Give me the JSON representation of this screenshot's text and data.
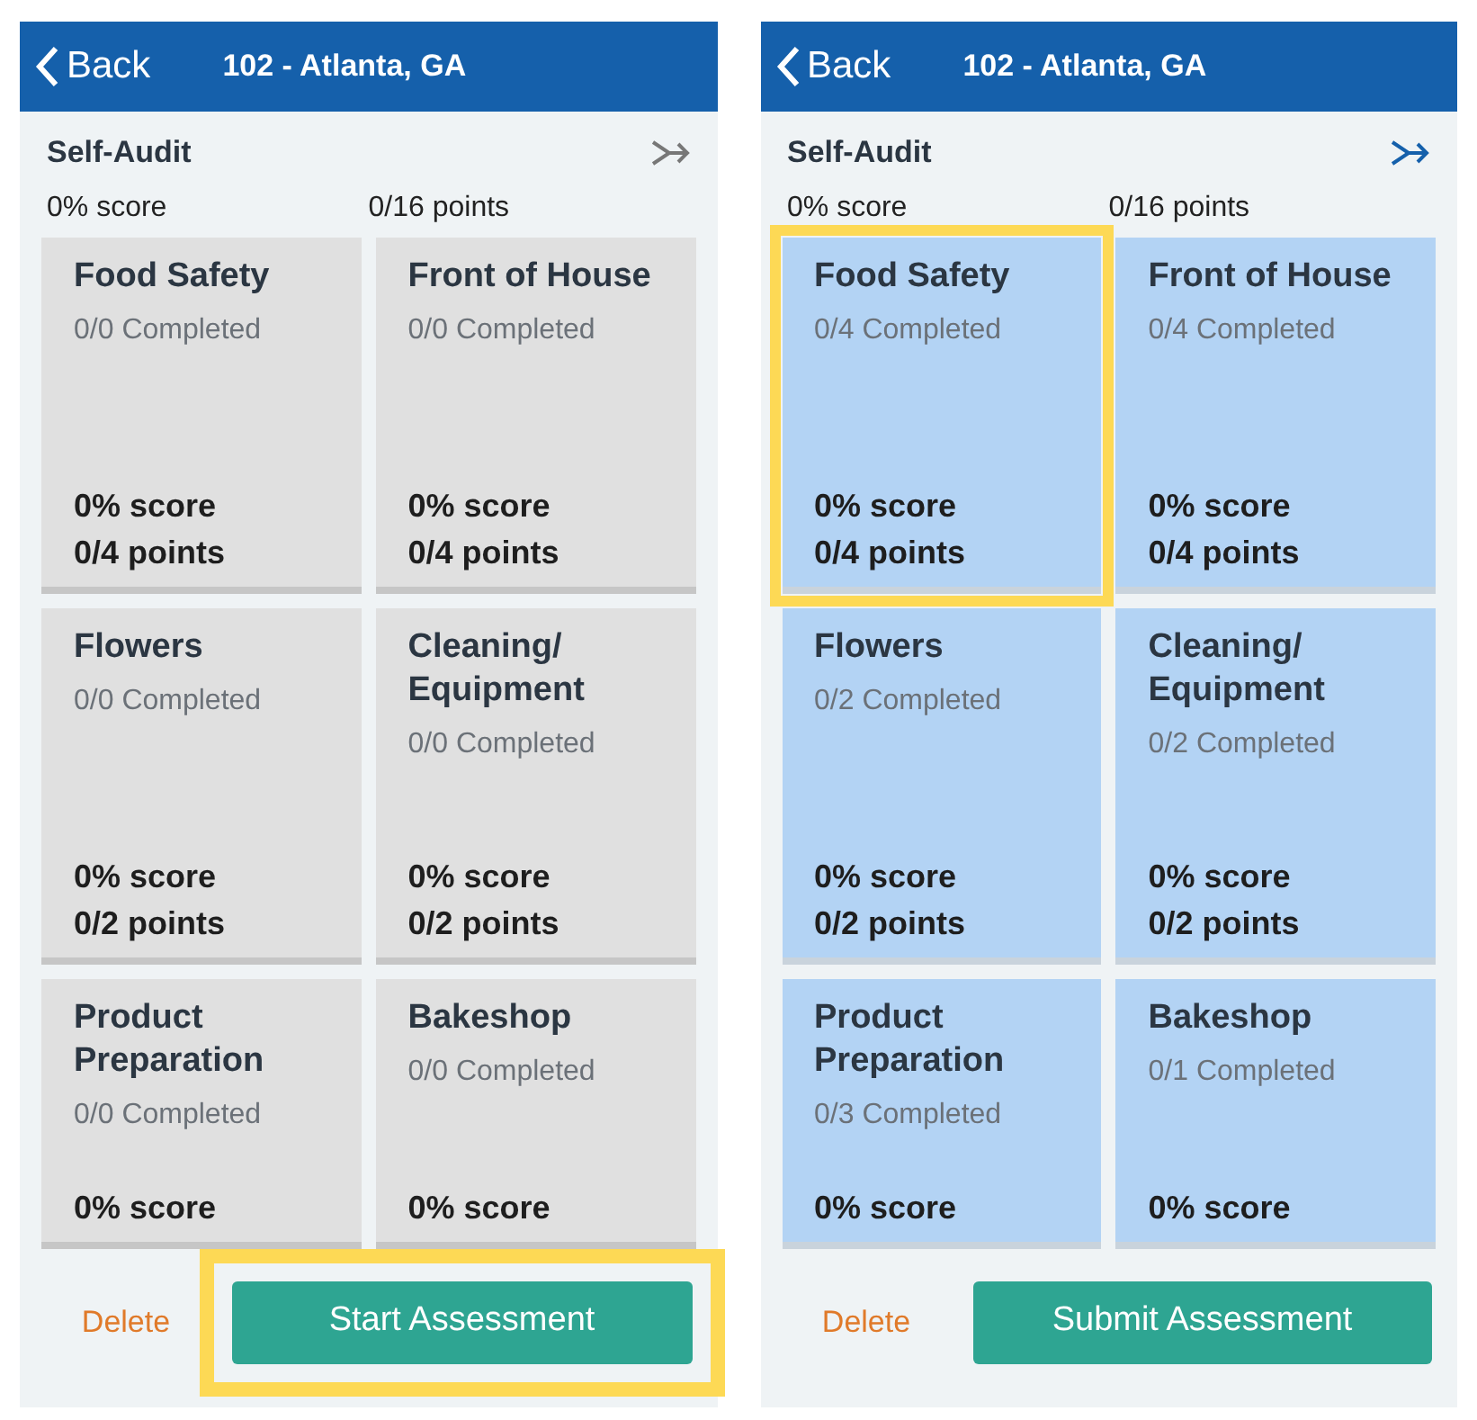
{
  "screens": [
    {
      "started": false,
      "back": "Back",
      "title": "102 - Atlanta, GA",
      "audit": "Self-Audit",
      "score": "0% score",
      "points": "0/16 points",
      "cards": [
        {
          "title": "Food Safety",
          "completed": "0/0 Completed",
          "score": "0% score",
          "points": "0/4 points",
          "highlighted": false
        },
        {
          "title": "Front of House",
          "completed": "0/0 Completed",
          "score": "0% score",
          "points": "0/4 points",
          "highlighted": false
        },
        {
          "title": "Flowers",
          "completed": "0/0 Completed",
          "score": "0% score",
          "points": "0/2 points",
          "highlighted": false
        },
        {
          "title": "Cleaning/ Equipment",
          "completed": "0/0 Completed",
          "score": "0% score",
          "points": "0/2 points",
          "highlighted": false
        },
        {
          "title": "Product Preparation",
          "completed": "0/0 Completed",
          "score": "0% score",
          "highlighted": false
        },
        {
          "title": "Bakeshop",
          "completed": "0/0 Completed",
          "score": "0% score",
          "highlighted": false
        }
      ],
      "delete": "Delete",
      "action": "Start Assessment",
      "action_highlighted": true
    },
    {
      "started": true,
      "back": "Back",
      "title": "102 - Atlanta, GA",
      "audit": "Self-Audit",
      "score": "0% score",
      "points": "0/16 points",
      "cards": [
        {
          "title": "Food Safety",
          "completed": "0/4 Completed",
          "score": "0% score",
          "points": "0/4 points",
          "highlighted": true
        },
        {
          "title": "Front of House",
          "completed": "0/4 Completed",
          "score": "0% score",
          "points": "0/4 points",
          "highlighted": false
        },
        {
          "title": "Flowers",
          "completed": "0/2 Completed",
          "score": "0% score",
          "points": "0/2 points",
          "highlighted": false
        },
        {
          "title": "Cleaning/ Equipment",
          "completed": "0/2 Completed",
          "score": "0% score",
          "points": "0/2 points",
          "highlighted": false
        },
        {
          "title": "Product Preparation",
          "completed": "0/3 Completed",
          "score": "0% score",
          "highlighted": false
        },
        {
          "title": "Bakeshop",
          "completed": "0/1 Completed",
          "score": "0% score",
          "highlighted": false
        }
      ],
      "delete": "Delete",
      "action": "Submit Assessment",
      "action_highlighted": false
    }
  ]
}
